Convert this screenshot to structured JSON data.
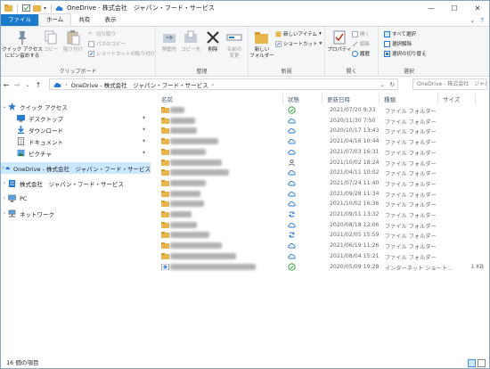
{
  "window": {
    "title": "OneDrive - 株式会社　ジャパン・フード・サービス"
  },
  "ribbon_tabs": [
    "ファイル",
    "ホーム",
    "共有",
    "表示"
  ],
  "ribbon": {
    "clipboard": {
      "group_label": "クリップボード",
      "pin_quick": "クイック アクセス\nにピン留めする",
      "copy": "コピー",
      "paste": "貼り付け",
      "cut": "切り取り",
      "copy_path": "パスのコピー",
      "paste_shortcut": "ショートカットの貼り付け"
    },
    "organize": {
      "group_label": "整理",
      "move_to": "移動先",
      "copy_to": "コピー先",
      "delete": "削除",
      "rename": "名前の\n変更"
    },
    "new": {
      "group_label": "新規",
      "new_folder": "新しい\nフォルダー",
      "new_item": "新しいアイテム",
      "shortcut": "ショートカット"
    },
    "open": {
      "group_label": "開く",
      "properties": "プロパティ",
      "open": "開く",
      "edit": "編集",
      "history": "履歴"
    },
    "select": {
      "group_label": "選択",
      "select_all": "すべて選択",
      "select_none": "選択解除",
      "invert": "選択の切り替え"
    }
  },
  "address": {
    "path": [
      "OneDrive - 株式会社　ジャパン・フード・サービス"
    ],
    "search_placeholder": "OneDrive - 株式会社　ジャパン..."
  },
  "nav": [
    {
      "label": "クイック アクセス",
      "icon": "star-icon",
      "expand": "v"
    },
    {
      "label": "デスクトップ",
      "icon": "desktop-icon",
      "pinned": true
    },
    {
      "label": "ダウンロード",
      "icon": "download-icon",
      "pinned": true
    },
    {
      "label": "ドキュメント",
      "icon": "document-icon",
      "pinned": true
    },
    {
      "label": "ピクチャ",
      "icon": "picture-icon",
      "pinned": true
    },
    {
      "label": "OneDrive - 株式会社　ジャパン・フード・サービス",
      "icon": "cloud-icon",
      "expand": ">",
      "selected": true
    },
    {
      "label": "株式会社　ジャパン・フード・サービス",
      "icon": "building-icon",
      "expand": ">"
    },
    {
      "label": "PC",
      "icon": "pc-icon",
      "expand": ">"
    },
    {
      "label": "ネットワーク",
      "icon": "network-icon",
      "expand": ">"
    }
  ],
  "columns": {
    "name": "名前",
    "status": "状態",
    "date": "更新日時",
    "type": "種類",
    "size": "サイズ"
  },
  "files": [
    {
      "status": "check",
      "date": "2021/07/20 9:33",
      "type": "ファイル フォルダー",
      "size": ""
    },
    {
      "status": "cloud",
      "date": "2020/11/30 7:50",
      "type": "ファイル フォルダー",
      "size": ""
    },
    {
      "status": "cloud",
      "date": "2020/10/17 13:43",
      "type": "ファイル フォルダー",
      "size": ""
    },
    {
      "status": "cloud",
      "date": "2021/04/16 10:44",
      "type": "ファイル フォルダー",
      "size": ""
    },
    {
      "status": "cloud",
      "date": "2021/07/03 16:31",
      "type": "ファイル フォルダー",
      "size": ""
    },
    {
      "status": "person",
      "date": "2021/10/02 18:24",
      "type": "ファイル フォルダー",
      "size": ""
    },
    {
      "status": "cloud",
      "date": "2021/04/11 10:02",
      "type": "ファイル フォルダー",
      "size": ""
    },
    {
      "status": "cloud",
      "date": "2021/07/24 11:40",
      "type": "ファイル フォルダー",
      "size": ""
    },
    {
      "status": "cloud",
      "date": "2021/09/28 11:34",
      "type": "ファイル フォルダー",
      "size": ""
    },
    {
      "status": "cloud",
      "date": "2021/10/02 16:36",
      "type": "ファイル フォルダー",
      "size": ""
    },
    {
      "status": "sync",
      "date": "2021/09/11 13:32",
      "type": "ファイル フォルダー",
      "size": ""
    },
    {
      "status": "cloud",
      "date": "2020/08/18 12:06",
      "type": "ファイル フォルダー",
      "size": ""
    },
    {
      "status": "sync",
      "date": "2021/02/05 15:59",
      "type": "ファイル フォルダー",
      "size": ""
    },
    {
      "status": "cloud",
      "date": "2021/06/19 11:26",
      "type": "ファイル フォルダー",
      "size": ""
    },
    {
      "status": "cloud",
      "date": "2021/08/04 15:21",
      "type": "ファイル フォルダー",
      "size": ""
    },
    {
      "status": "check",
      "date": "2020/05/09 19:28",
      "type": "インターネット ショート...",
      "size": "1 KB"
    }
  ],
  "status_bar": {
    "item_count": "16 個の項目"
  },
  "colors": {
    "accent": "#1979ca",
    "selected_bg": "#cce8ff",
    "folder": "#e8b64c",
    "cloud": "#2a7bd4",
    "check": "#3ca14a"
  }
}
